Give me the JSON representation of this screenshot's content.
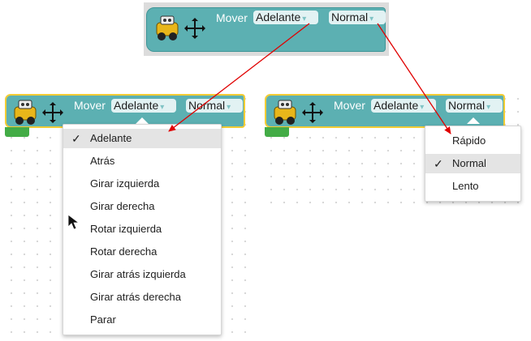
{
  "block": {
    "label": "Mover",
    "direction_value": "Adelante",
    "speed_value": "Normal",
    "arrow_glyph": "▾"
  },
  "direction_menu": {
    "items": [
      "Adelante",
      "Atrás",
      "Girar izquierda",
      "Girar derecha",
      "Rotar izquierda",
      "Rotar derecha",
      "Girar atrás izquierda",
      "Girar atrás derecha",
      "Parar"
    ],
    "selected": "Adelante",
    "check": "✓"
  },
  "speed_menu": {
    "items": [
      "Rápido",
      "Normal",
      "Lento"
    ],
    "selected": "Normal",
    "check": "✓"
  },
  "colors": {
    "block": "#5cb0b2",
    "highlight": "#f2cc35",
    "green_tab": "#43ac46",
    "annotation_arrow": "#e00000"
  },
  "icons": [
    "robot-icon",
    "move-arrows-icon",
    "dropdown-arrow-icon",
    "checkmark-icon",
    "mouse-cursor-icon"
  ]
}
